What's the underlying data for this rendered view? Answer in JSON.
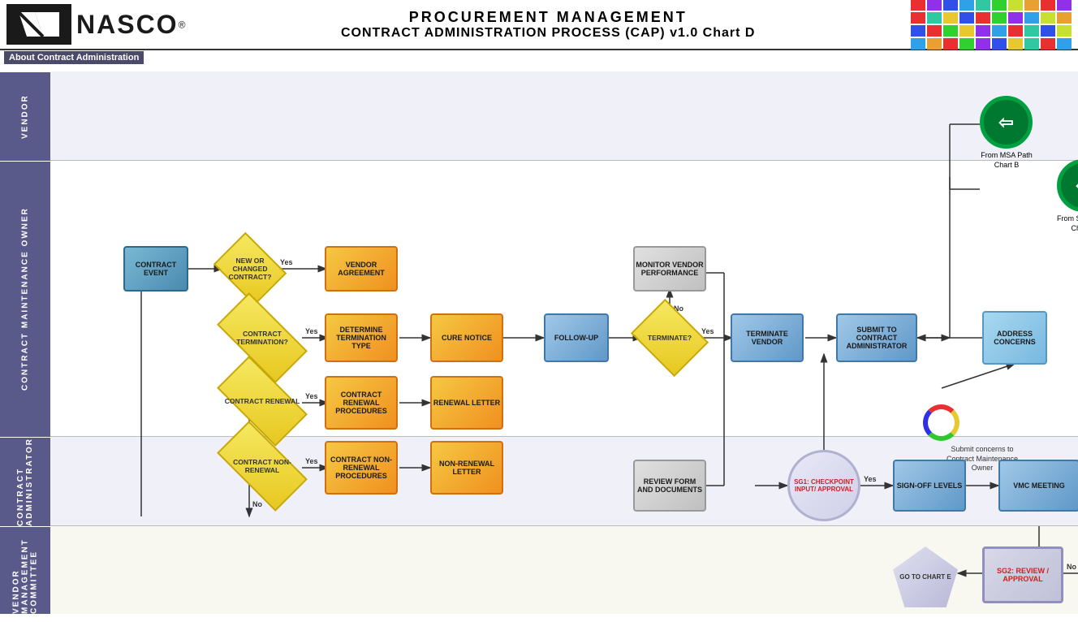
{
  "header": {
    "title_line1": "PROCUREMENT MANAGEMENT",
    "title_line2": "CONTRACT ADMINISTRATION PROCESS (CAP) v1.0 Chart D",
    "logo_name": "NASCO",
    "registered": "®"
  },
  "about": "About Contract Administration",
  "lanes": {
    "vendor": "VENDOR",
    "cmo": "CONTRACT MAINTENANCE OWNER",
    "ca": "CONTRACT ADMINISTRATOR",
    "vmc": "VENDOR MANAGEMENT COMMITTEE"
  },
  "nodes": {
    "contract_event": "CONTRACT EVENT",
    "new_changed": "NEW OR CHANGED CONTRACT?",
    "vendor_agreement": "VENDOR AGREEMENT",
    "contract_termination": "CONTRACT TERMINATION?",
    "determine_term": "DETERMINE TERMINATION TYPE",
    "cure_notice": "CURE NOTICE",
    "follow_up": "FOLLOW-UP",
    "terminate_q": "TERMINATE?",
    "terminate_vendor": "TERMINATE VENDOR",
    "submit_ca": "SUBMIT TO CONTRACT ADMINISTRATOR",
    "address_concerns": "ADDRESS CONCERNS",
    "monitor_vendor": "MONITOR VENDOR PERFORMANCE",
    "contract_renewal": "CONTRACT RENEWAL",
    "renewal_procedures": "CONTRACT RENEWAL PROCEDURES",
    "renewal_letter": "RENEWAL LETTER",
    "contract_nonrenewal": "CONTRACT NON-RENEWAL",
    "nonrenewal_procedures": "CONTRACT NON-RENEWAL PROCEDURES",
    "nonrenewal_letter": "NON-RENEWAL LETTER",
    "review_form": "REVIEW FORM AND DOCUMENTS",
    "sg1": "SG1: CHECKPOINT INPUT/ APPROVAL",
    "sign_off": "SIGN-OFF LEVELS",
    "vmc_meeting": "VMC MEETING",
    "go_chart_e": "GO TO CHART E",
    "sg2": "SG2: REVIEW / APPROVAL",
    "from_msa": "From MSA Path Chart B",
    "from_sow": "From SOW Path Chart C",
    "submit_concerns": "Submit concerns to Contract Maintenance Owner"
  },
  "colorblock": [
    "#e83030",
    "#9030e8",
    "#3050e8",
    "#30a0e8",
    "#30c8a0",
    "#30d030",
    "#c8e030",
    "#e8a030",
    "#e83030",
    "#9030e8",
    "#e83030",
    "#30c8a0",
    "#e8c830",
    "#3050e8",
    "#e83030",
    "#30d030",
    "#9030e8",
    "#30a0e8",
    "#c8e030",
    "#e8a030",
    "#3050e8",
    "#e83030",
    "#30d030",
    "#e8c830",
    "#9030e8",
    "#30a0e8",
    "#e83030",
    "#30c8a0",
    "#3050e8",
    "#c8e030",
    "#30a0e8",
    "#e8a030",
    "#e83030",
    "#30d030",
    "#9030e8",
    "#3050e8",
    "#e8c830",
    "#30c8a0",
    "#e83030",
    "#30a0e8"
  ]
}
